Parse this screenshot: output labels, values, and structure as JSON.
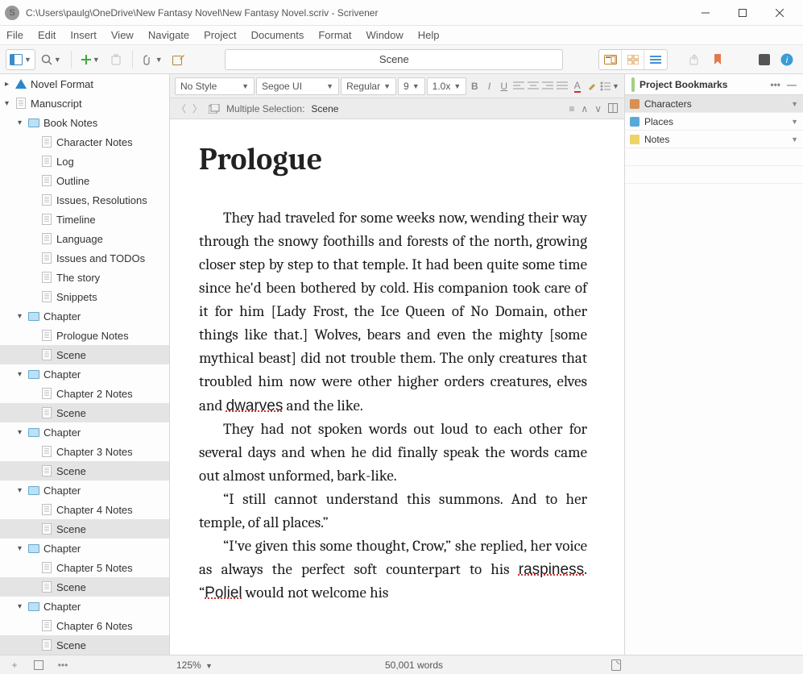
{
  "window": {
    "title": "C:\\Users\\paulg\\OneDrive\\New Fantasy Novel\\New Fantasy Novel.scriv - Scrivener"
  },
  "menu": [
    "File",
    "Edit",
    "Insert",
    "View",
    "Navigate",
    "Project",
    "Documents",
    "Format",
    "Window",
    "Help"
  ],
  "toolbar": {
    "doc_title": "Scene"
  },
  "format": {
    "style": "No Style",
    "font": "Segoe UI",
    "weight": "Regular",
    "size": "9",
    "spacing": "1.0x"
  },
  "path": {
    "label": "Multiple Selection:",
    "value": "Scene"
  },
  "binder": [
    {
      "d": 0,
      "t": "Novel Format",
      "ic": "warn",
      "exp": false
    },
    {
      "d": 0,
      "t": "Manuscript",
      "ic": "doc",
      "exp": true
    },
    {
      "d": 1,
      "t": "Book Notes",
      "ic": "folder",
      "exp": true
    },
    {
      "d": 2,
      "t": "Character Notes",
      "ic": "doc"
    },
    {
      "d": 2,
      "t": "Log",
      "ic": "doc"
    },
    {
      "d": 2,
      "t": "Outline",
      "ic": "doc"
    },
    {
      "d": 2,
      "t": "Issues, Resolutions",
      "ic": "doc"
    },
    {
      "d": 2,
      "t": "Timeline",
      "ic": "doc"
    },
    {
      "d": 2,
      "t": "Language",
      "ic": "doc"
    },
    {
      "d": 2,
      "t": "Issues and TODOs",
      "ic": "doc"
    },
    {
      "d": 2,
      "t": "The story",
      "ic": "doc"
    },
    {
      "d": 2,
      "t": "Snippets",
      "ic": "doc"
    },
    {
      "d": 1,
      "t": "Chapter",
      "ic": "folder",
      "exp": true
    },
    {
      "d": 2,
      "t": "Prologue Notes",
      "ic": "doc"
    },
    {
      "d": 2,
      "t": "Scene",
      "ic": "doc",
      "sel": true
    },
    {
      "d": 1,
      "t": "Chapter",
      "ic": "folder",
      "exp": true
    },
    {
      "d": 2,
      "t": "Chapter 2 Notes",
      "ic": "doc"
    },
    {
      "d": 2,
      "t": "Scene",
      "ic": "doc",
      "sel": true
    },
    {
      "d": 1,
      "t": "Chapter",
      "ic": "folder",
      "exp": true
    },
    {
      "d": 2,
      "t": "Chapter 3 Notes",
      "ic": "doc"
    },
    {
      "d": 2,
      "t": "Scene",
      "ic": "doc",
      "sel": true
    },
    {
      "d": 1,
      "t": "Chapter",
      "ic": "folder",
      "exp": true
    },
    {
      "d": 2,
      "t": "Chapter 4 Notes",
      "ic": "doc"
    },
    {
      "d": 2,
      "t": "Scene",
      "ic": "doc",
      "sel": true
    },
    {
      "d": 1,
      "t": "Chapter",
      "ic": "folder",
      "exp": true
    },
    {
      "d": 2,
      "t": "Chapter 5 Notes",
      "ic": "doc"
    },
    {
      "d": 2,
      "t": "Scene",
      "ic": "doc",
      "sel": true
    },
    {
      "d": 1,
      "t": "Chapter",
      "ic": "folder",
      "exp": true
    },
    {
      "d": 2,
      "t": "Chapter 6 Notes",
      "ic": "doc"
    },
    {
      "d": 2,
      "t": "Scene",
      "ic": "doc",
      "sel": true
    }
  ],
  "doc": {
    "h1": "Prologue",
    "paragraphs": [
      "They had traveled for some weeks now, wending their way through the snowy foothills and forests of the north, growing closer step by step to that temple. It had been quite some time since he'd been bothered by cold. His companion took care of it for him [Lady Frost, the Ice Queen of No Domain, other things like that.] Wolves, bears and even the mighty [some mythical beast] did not trouble them. The only creatures that troubled him now were other higher orders creatures, elves and <sq>dwarves</sq> and the like.",
      "They had not spoken words out loud to each other for several days and when he did finally speak the words came out almost unformed, bark-like.",
      "“I still cannot understand this summons. And to her temple, of all places.”",
      "“I've given this some thought, Crow,” she replied, her voice as always the perfect soft counterpart to his <sq>raspiness</sq>. “<sq>Poliel</sq> would not welcome his"
    ]
  },
  "inspector": {
    "title": "Project Bookmarks",
    "items": [
      {
        "t": "Characters",
        "ic": "char",
        "sel": true
      },
      {
        "t": "Places",
        "ic": "place"
      },
      {
        "t": "Notes",
        "ic": "note"
      }
    ]
  },
  "status": {
    "zoom": "125%",
    "wc": "50,001 words"
  }
}
